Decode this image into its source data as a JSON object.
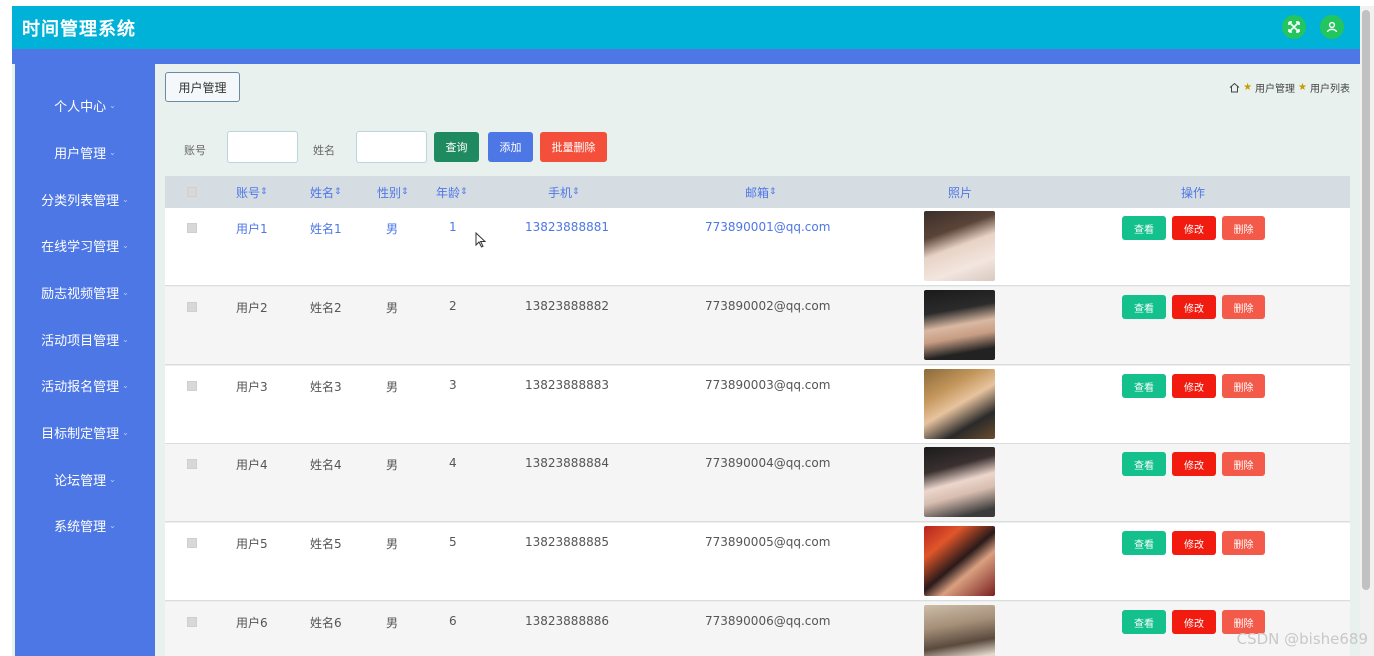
{
  "app": {
    "title": "时间管理系统"
  },
  "topbar": {
    "fullscreen_icon": "expand-icon",
    "user_icon": "user-icon",
    "accent": "#00b2d8",
    "button_color": "#22c55e"
  },
  "sidebar": {
    "items": [
      {
        "label": "个人中心"
      },
      {
        "label": "用户管理"
      },
      {
        "label": "分类列表管理"
      },
      {
        "label": "在线学习管理"
      },
      {
        "label": "励志视频管理"
      },
      {
        "label": "活动项目管理"
      },
      {
        "label": "活动报名管理"
      },
      {
        "label": "目标制定管理"
      },
      {
        "label": "论坛管理"
      },
      {
        "label": "系统管理"
      }
    ],
    "caret": "⌄",
    "color": "#4e77e6"
  },
  "content": {
    "section_tab": "用户管理",
    "breadcrumb": {
      "home_icon": "home-icon",
      "level1": "用户管理",
      "level2": "用户列表"
    }
  },
  "search": {
    "account_label": "账号",
    "account_value": "",
    "name_label": "姓名",
    "name_value": "",
    "query_label": "查询",
    "add_label": "添加",
    "batch_delete_label": "批量删除"
  },
  "table": {
    "headers": [
      "账号",
      "姓名",
      "性别",
      "年龄",
      "手机",
      "邮箱",
      "照片",
      "操作"
    ],
    "sort_glyph": "⇕",
    "rows": [
      {
        "account": "用户1",
        "name": "姓名1",
        "gender": "男",
        "age": "1",
        "phone": "13823888881",
        "email": "773890001@qq.com"
      },
      {
        "account": "用户2",
        "name": "姓名2",
        "gender": "男",
        "age": "2",
        "phone": "13823888882",
        "email": "773890002@qq.com"
      },
      {
        "account": "用户3",
        "name": "姓名3",
        "gender": "男",
        "age": "3",
        "phone": "13823888883",
        "email": "773890003@qq.com"
      },
      {
        "account": "用户4",
        "name": "姓名4",
        "gender": "男",
        "age": "4",
        "phone": "13823888884",
        "email": "773890004@qq.com"
      },
      {
        "account": "用户5",
        "name": "姓名5",
        "gender": "男",
        "age": "5",
        "phone": "13823888885",
        "email": "773890005@qq.com"
      },
      {
        "account": "用户6",
        "name": "姓名6",
        "gender": "男",
        "age": "6",
        "phone": "13823888886",
        "email": "773890006@qq.com"
      }
    ],
    "actions": {
      "view": "查看",
      "edit": "修改",
      "delete": "删除"
    }
  },
  "watermark": "CSDN @bishe689"
}
